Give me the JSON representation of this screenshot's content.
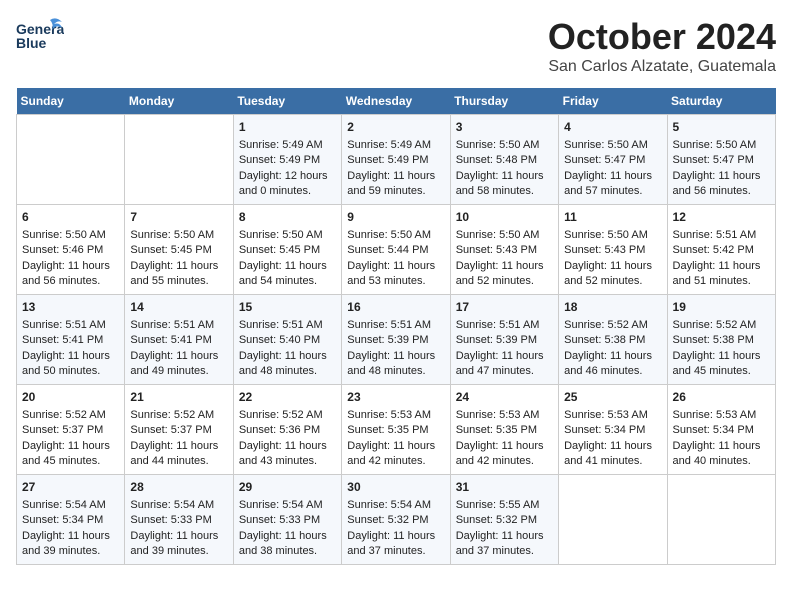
{
  "header": {
    "logo_line1": "General",
    "logo_line2": "Blue",
    "month": "October 2024",
    "location": "San Carlos Alzatate, Guatemala"
  },
  "days_of_week": [
    "Sunday",
    "Monday",
    "Tuesday",
    "Wednesday",
    "Thursday",
    "Friday",
    "Saturday"
  ],
  "weeks": [
    [
      {
        "day": "",
        "info": ""
      },
      {
        "day": "",
        "info": ""
      },
      {
        "day": "1",
        "info": "Sunrise: 5:49 AM\nSunset: 5:49 PM\nDaylight: 12 hours\nand 0 minutes."
      },
      {
        "day": "2",
        "info": "Sunrise: 5:49 AM\nSunset: 5:49 PM\nDaylight: 11 hours\nand 59 minutes."
      },
      {
        "day": "3",
        "info": "Sunrise: 5:50 AM\nSunset: 5:48 PM\nDaylight: 11 hours\nand 58 minutes."
      },
      {
        "day": "4",
        "info": "Sunrise: 5:50 AM\nSunset: 5:47 PM\nDaylight: 11 hours\nand 57 minutes."
      },
      {
        "day": "5",
        "info": "Sunrise: 5:50 AM\nSunset: 5:47 PM\nDaylight: 11 hours\nand 56 minutes."
      }
    ],
    [
      {
        "day": "6",
        "info": "Sunrise: 5:50 AM\nSunset: 5:46 PM\nDaylight: 11 hours\nand 56 minutes."
      },
      {
        "day": "7",
        "info": "Sunrise: 5:50 AM\nSunset: 5:45 PM\nDaylight: 11 hours\nand 55 minutes."
      },
      {
        "day": "8",
        "info": "Sunrise: 5:50 AM\nSunset: 5:45 PM\nDaylight: 11 hours\nand 54 minutes."
      },
      {
        "day": "9",
        "info": "Sunrise: 5:50 AM\nSunset: 5:44 PM\nDaylight: 11 hours\nand 53 minutes."
      },
      {
        "day": "10",
        "info": "Sunrise: 5:50 AM\nSunset: 5:43 PM\nDaylight: 11 hours\nand 52 minutes."
      },
      {
        "day": "11",
        "info": "Sunrise: 5:50 AM\nSunset: 5:43 PM\nDaylight: 11 hours\nand 52 minutes."
      },
      {
        "day": "12",
        "info": "Sunrise: 5:51 AM\nSunset: 5:42 PM\nDaylight: 11 hours\nand 51 minutes."
      }
    ],
    [
      {
        "day": "13",
        "info": "Sunrise: 5:51 AM\nSunset: 5:41 PM\nDaylight: 11 hours\nand 50 minutes."
      },
      {
        "day": "14",
        "info": "Sunrise: 5:51 AM\nSunset: 5:41 PM\nDaylight: 11 hours\nand 49 minutes."
      },
      {
        "day": "15",
        "info": "Sunrise: 5:51 AM\nSunset: 5:40 PM\nDaylight: 11 hours\nand 48 minutes."
      },
      {
        "day": "16",
        "info": "Sunrise: 5:51 AM\nSunset: 5:39 PM\nDaylight: 11 hours\nand 48 minutes."
      },
      {
        "day": "17",
        "info": "Sunrise: 5:51 AM\nSunset: 5:39 PM\nDaylight: 11 hours\nand 47 minutes."
      },
      {
        "day": "18",
        "info": "Sunrise: 5:52 AM\nSunset: 5:38 PM\nDaylight: 11 hours\nand 46 minutes."
      },
      {
        "day": "19",
        "info": "Sunrise: 5:52 AM\nSunset: 5:38 PM\nDaylight: 11 hours\nand 45 minutes."
      }
    ],
    [
      {
        "day": "20",
        "info": "Sunrise: 5:52 AM\nSunset: 5:37 PM\nDaylight: 11 hours\nand 45 minutes."
      },
      {
        "day": "21",
        "info": "Sunrise: 5:52 AM\nSunset: 5:37 PM\nDaylight: 11 hours\nand 44 minutes."
      },
      {
        "day": "22",
        "info": "Sunrise: 5:52 AM\nSunset: 5:36 PM\nDaylight: 11 hours\nand 43 minutes."
      },
      {
        "day": "23",
        "info": "Sunrise: 5:53 AM\nSunset: 5:35 PM\nDaylight: 11 hours\nand 42 minutes."
      },
      {
        "day": "24",
        "info": "Sunrise: 5:53 AM\nSunset: 5:35 PM\nDaylight: 11 hours\nand 42 minutes."
      },
      {
        "day": "25",
        "info": "Sunrise: 5:53 AM\nSunset: 5:34 PM\nDaylight: 11 hours\nand 41 minutes."
      },
      {
        "day": "26",
        "info": "Sunrise: 5:53 AM\nSunset: 5:34 PM\nDaylight: 11 hours\nand 40 minutes."
      }
    ],
    [
      {
        "day": "27",
        "info": "Sunrise: 5:54 AM\nSunset: 5:34 PM\nDaylight: 11 hours\nand 39 minutes."
      },
      {
        "day": "28",
        "info": "Sunrise: 5:54 AM\nSunset: 5:33 PM\nDaylight: 11 hours\nand 39 minutes."
      },
      {
        "day": "29",
        "info": "Sunrise: 5:54 AM\nSunset: 5:33 PM\nDaylight: 11 hours\nand 38 minutes."
      },
      {
        "day": "30",
        "info": "Sunrise: 5:54 AM\nSunset: 5:32 PM\nDaylight: 11 hours\nand 37 minutes."
      },
      {
        "day": "31",
        "info": "Sunrise: 5:55 AM\nSunset: 5:32 PM\nDaylight: 11 hours\nand 37 minutes."
      },
      {
        "day": "",
        "info": ""
      },
      {
        "day": "",
        "info": ""
      }
    ]
  ]
}
